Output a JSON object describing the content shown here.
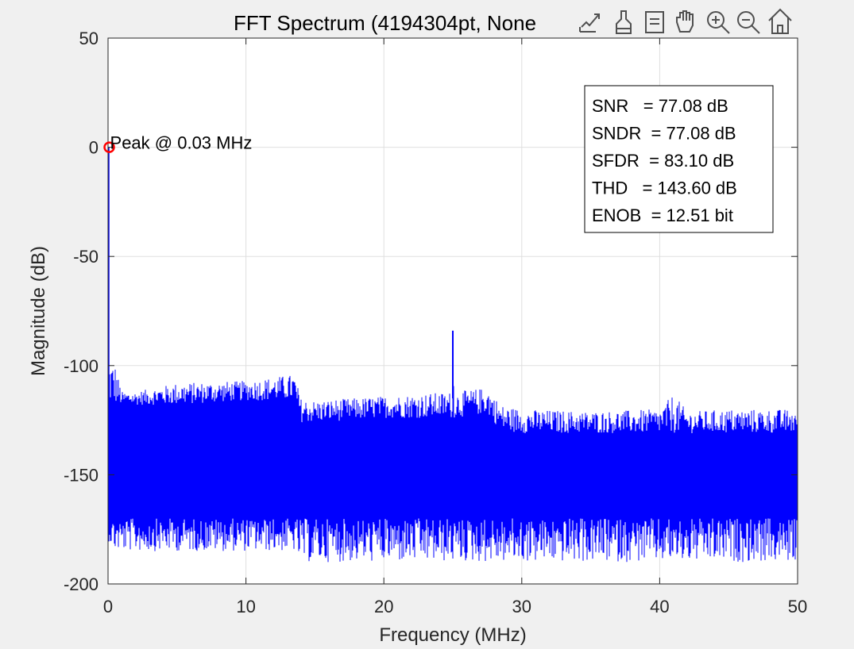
{
  "chart_data": {
    "type": "line",
    "title": "FFT Spectrum (4194304pt, None",
    "xlabel": "Frequency (MHz)",
    "ylabel": "Magnitude (dB)",
    "xlim": [
      0,
      50
    ],
    "ylim": [
      -200,
      50
    ],
    "xticks": [
      0,
      10,
      20,
      30,
      40,
      50
    ],
    "yticks": [
      50,
      0,
      -50,
      -100,
      -150,
      -200
    ],
    "grid": true,
    "series": [
      {
        "color": "#0000ff",
        "envelope": {
          "freq_mhz": [
            0.0,
            0.5,
            1.0,
            2.0,
            5.0,
            10.0,
            13.5,
            14.0,
            15.0,
            20.0,
            24.9,
            25.0,
            25.1,
            27.5,
            28.5,
            30.0,
            35.0,
            40.0,
            41.0,
            42.0,
            45.0,
            50.0
          ],
          "upper_db": [
            -97,
            -99,
            -112,
            -112,
            -108,
            -107,
            -104,
            -115,
            -116,
            -114,
            -112,
            -84,
            -112,
            -110,
            -118,
            -120,
            -121,
            -120,
            -113,
            -121,
            -120,
            -120
          ],
          "lower_db": [
            -180,
            -185,
            -185,
            -185,
            -185,
            -185,
            -185,
            -190,
            -190,
            -190,
            -190,
            -190,
            -190,
            -190,
            -190,
            -190,
            -190,
            -190,
            -190,
            -190,
            -190,
            -190
          ],
          "dense_top_db": [
            -118,
            -118,
            -118,
            -118,
            -118,
            -116,
            -116,
            -126,
            -126,
            -124,
            -124,
            -124,
            -124,
            -122,
            -130,
            -131,
            -131,
            -131,
            -131,
            -131,
            -131,
            -131
          ],
          "dense_bot_db": [
            -170,
            -170,
            -170,
            -170,
            -170,
            -170,
            -170,
            -170,
            -170,
            -170,
            -170,
            -170,
            -170,
            -170,
            -170,
            -170,
            -170,
            -170,
            -170,
            -170,
            -170,
            -170
          ]
        }
      }
    ],
    "peak_marker": {
      "x": 0.03,
      "y": 0,
      "color": "#ff0000",
      "label": "Peak @ 0.03 MHz"
    },
    "metrics_box": {
      "lines": [
        "SNR   = 77.08 dB",
        "SNDR  = 77.08 dB",
        "SFDR  = 83.10 dB",
        "THD   = 143.60 dB",
        "ENOB  = 12.51 bit"
      ]
    }
  },
  "toolbar": {
    "icons": [
      "export-icon",
      "brush-icon",
      "datatip-icon",
      "pan-icon",
      "zoom-in-icon",
      "zoom-out-icon",
      "home-icon"
    ]
  }
}
